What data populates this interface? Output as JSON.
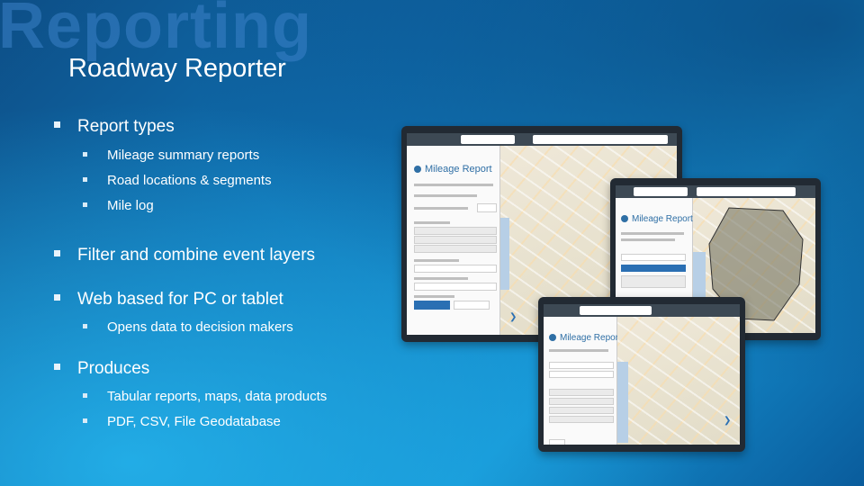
{
  "watermark": "Reporting",
  "title": "Roadway Reporter",
  "bullets": [
    {
      "text": "Report types",
      "sub": [
        "Mileage summary reports",
        "Road locations & segments",
        "Mile log"
      ]
    },
    {
      "text": "Filter and combine event layers",
      "sub": []
    },
    {
      "text": "Web based for PC or tablet",
      "sub": [
        "Opens data to decision makers"
      ]
    },
    {
      "text": "Produces",
      "sub": [
        "Tabular reports, maps, data products",
        "PDF, CSV, File Geodatabase"
      ]
    }
  ],
  "screens": {
    "app_title": "Mileage Report",
    "app_title_2": "Mileage Report",
    "app_title_3": "Mileage Report"
  }
}
